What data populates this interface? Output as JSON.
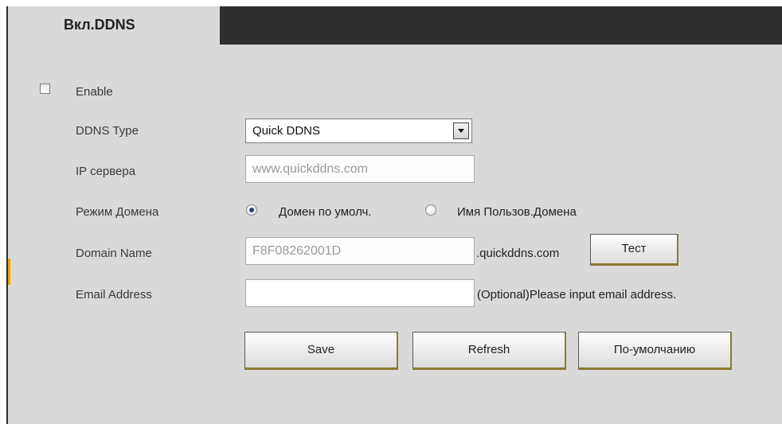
{
  "tabs": [
    {
      "label": "Вкл.DDNS"
    }
  ],
  "form": {
    "enable_label": "Enable",
    "enable_checked": false,
    "ddns_type_label": "DDNS Type",
    "ddns_type_value": "Quick DDNS",
    "server_ip_label": "IP сервера",
    "server_ip_value": "www.quickddns.com",
    "domain_mode_label": "Режим Домена",
    "domain_mode_options": [
      "Домен по умолч.",
      "Имя Пользов.Домена"
    ],
    "domain_mode_selected": "Домен по умолч.",
    "domain_name_label": "Domain Name",
    "domain_name_value": "F8F08262001D",
    "domain_suffix": ".quickddns.com",
    "test_button": "Тест",
    "email_label": "Email Address",
    "email_value": "",
    "email_hint": "(Optional)Please input email address."
  },
  "actions": {
    "save": "Save",
    "refresh": "Refresh",
    "default": "По-умолчанию"
  },
  "colors": {
    "accent": "#f5a000",
    "tabbar": "#2e2e2e",
    "panel": "#d9d9d9"
  }
}
